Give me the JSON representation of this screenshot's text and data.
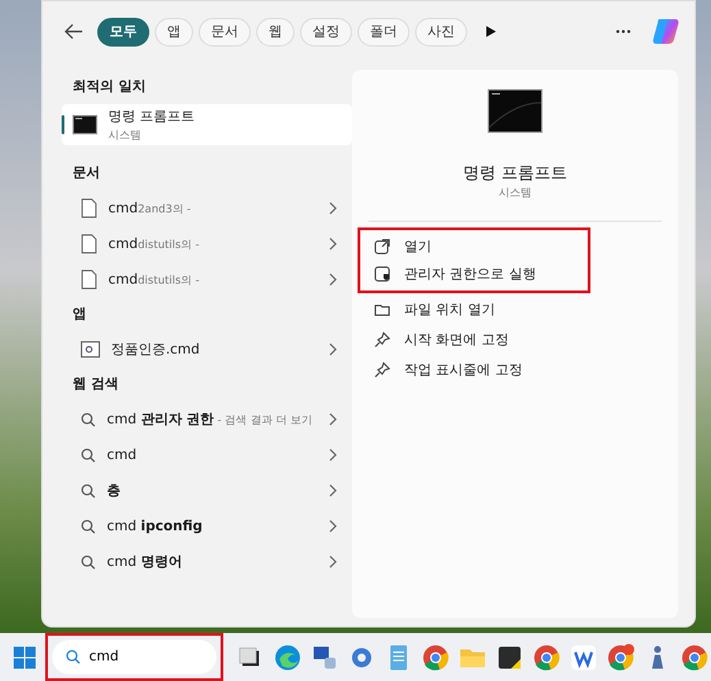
{
  "filters": [
    {
      "label": "모두",
      "selected": true
    },
    {
      "label": "앱",
      "selected": false
    },
    {
      "label": "문서",
      "selected": false
    },
    {
      "label": "웹",
      "selected": false
    },
    {
      "label": "설정",
      "selected": false
    },
    {
      "label": "폴더",
      "selected": false
    },
    {
      "label": "사진",
      "selected": false
    }
  ],
  "best_match": {
    "heading": "최적의 일치",
    "title": "명령 프롬프트",
    "subtitle": "시스템",
    "selected": true
  },
  "documents": {
    "heading": "문서",
    "items": [
      {
        "name": "cmd",
        "detail": "2and3의 -"
      },
      {
        "name": "cmd",
        "detail": "distutils의 -"
      },
      {
        "name": "cmd",
        "detail": "distutils의 -"
      }
    ]
  },
  "apps": {
    "heading": "앱",
    "items": [
      {
        "name": "정품인증.cmd"
      }
    ]
  },
  "web_search": {
    "heading": "웹 검색",
    "items": [
      {
        "text": "cmd **관리자 권한**",
        "hint": "- 검색 결과 더 보기"
      },
      {
        "text": "cmd"
      },
      {
        "text": "**층**"
      },
      {
        "text": "cmd **ipconfig**"
      },
      {
        "text": "cmd **명령어**"
      }
    ]
  },
  "preview": {
    "title": "명령 프롬프트",
    "subtitle": "시스템",
    "actions": [
      {
        "kind": "open",
        "label": "열기",
        "highlighted": true
      },
      {
        "kind": "admin",
        "label": "관리자 권한으로 실행",
        "highlighted": true
      },
      {
        "kind": "folder",
        "label": "파일 위치 열기",
        "highlighted": false
      },
      {
        "kind": "pin",
        "label": "시작 화면에 고정",
        "highlighted": false
      },
      {
        "kind": "pin",
        "label": "작업 표시줄에 고정",
        "highlighted": false
      }
    ]
  },
  "taskbar": {
    "search": {
      "value": "cmd",
      "highlighted": true
    }
  }
}
